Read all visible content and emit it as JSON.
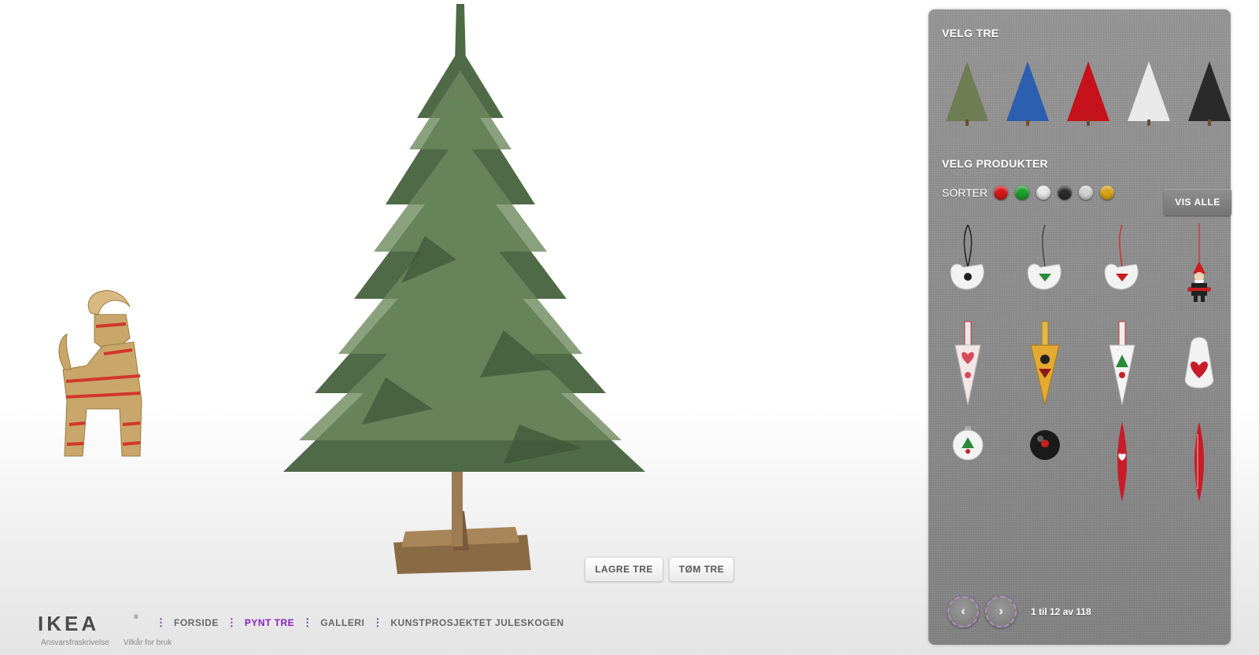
{
  "scene": {
    "save_label": "LAGRE TRE",
    "clear_label": "TØM TRE"
  },
  "footer": {
    "logo": "IKEA",
    "logo_reg": "®",
    "nav": [
      {
        "label": "FORSIDE",
        "active": false
      },
      {
        "label": "PYNT TRE",
        "active": true
      },
      {
        "label": "GALLERI",
        "active": false
      },
      {
        "label": "KUNSTPROSJEKTET JULESKOGEN",
        "active": false
      }
    ],
    "links": [
      "Ansvarsfraskrivelse",
      "Vilkår for bruk"
    ]
  },
  "panel": {
    "choose_tree_heading": "VELG TRE",
    "tree_options": [
      {
        "icon": "green-tree-icon",
        "color": "#6f7d55"
      },
      {
        "icon": "blue-tree-icon",
        "color": "#2c5fb0"
      },
      {
        "icon": "red-tree-icon",
        "color": "#c5121b"
      },
      {
        "icon": "white-tree-icon",
        "color": "#e9e9e9"
      },
      {
        "icon": "black-tree-icon",
        "color": "#2a2a2a"
      }
    ],
    "choose_products_heading": "VELG PRODUKTER",
    "sort_label": "SORTER",
    "sort_colors": [
      "#d81818",
      "#1ea02c",
      "#e6e6e6",
      "#2c2c2c",
      "#d2d2d2",
      "#d8a319"
    ],
    "show_all_label": "VIS ALLE",
    "products": [
      {
        "icon": "white-bird-ornament-icon"
      },
      {
        "icon": "green-pattern-bird-ornament-icon"
      },
      {
        "icon": "red-pattern-bird-ornament-icon"
      },
      {
        "icon": "santa-ornament-icon"
      },
      {
        "icon": "red-heart-cone-ornament-icon"
      },
      {
        "icon": "yellow-cone-ornament-icon"
      },
      {
        "icon": "green-cone-ornament-icon"
      },
      {
        "icon": "heart-sack-ornament-icon"
      },
      {
        "icon": "white-bauble-icon"
      },
      {
        "icon": "black-bauble-icon"
      },
      {
        "icon": "red-drop-ornament-icon"
      },
      {
        "icon": "red-drop-ornament-icon"
      }
    ],
    "pager": {
      "prev": "‹",
      "next": "›",
      "count": "1 til 12 av 118"
    }
  }
}
